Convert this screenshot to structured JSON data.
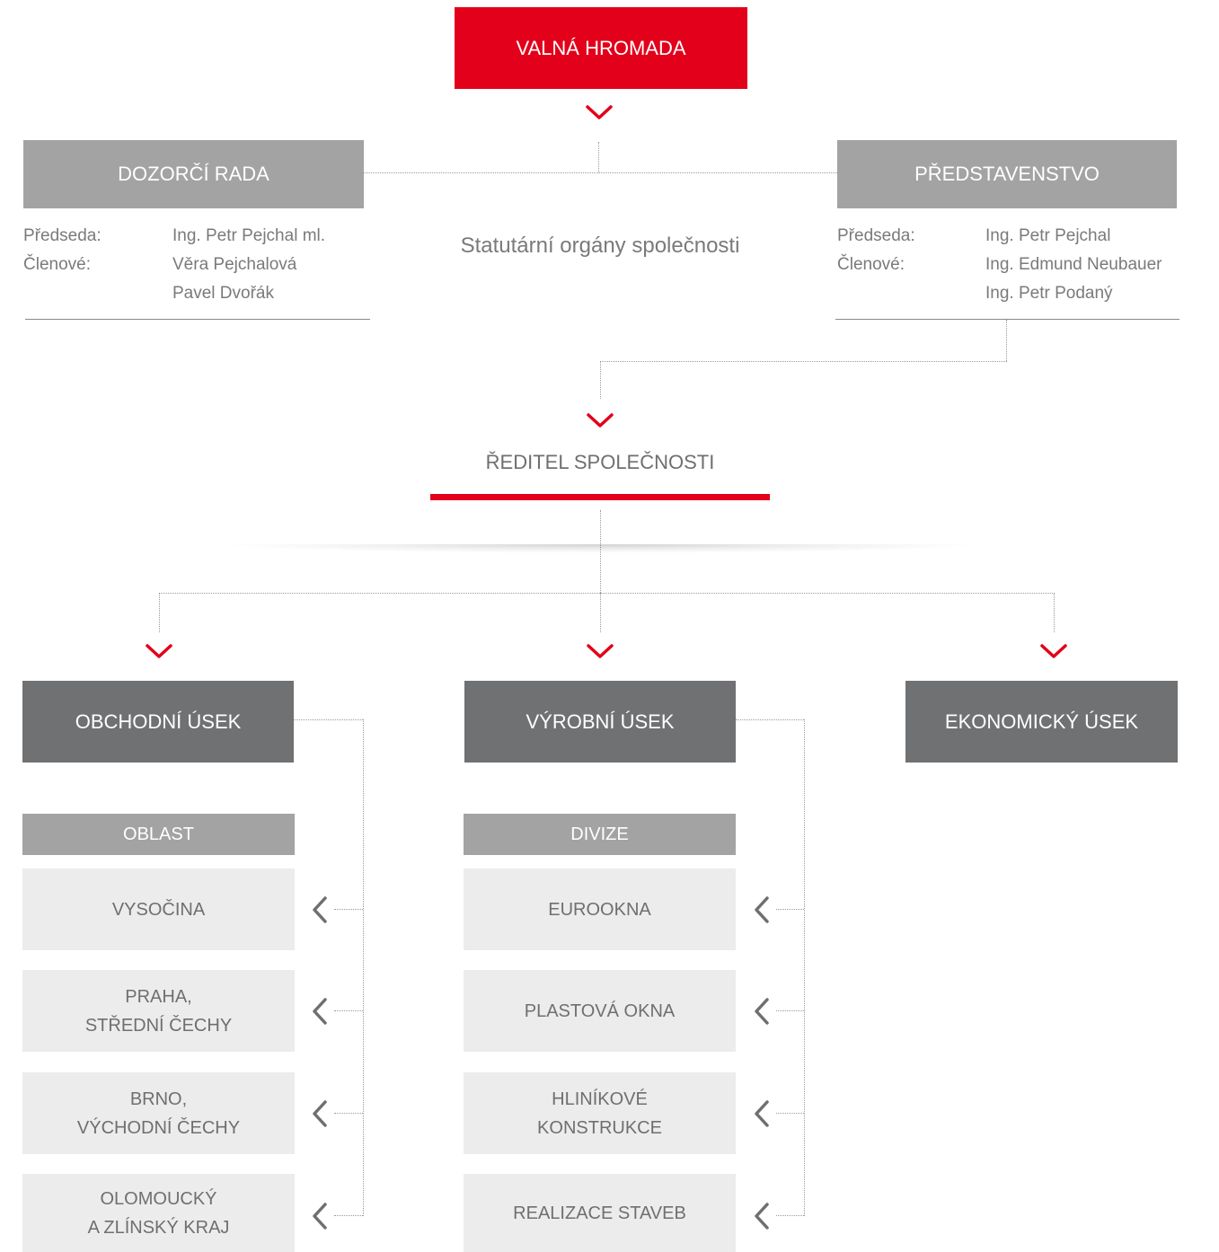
{
  "top": {
    "title": "VALNÁ HROMADA"
  },
  "dozorci": {
    "title": "DOZORČÍ RADA",
    "role_chair": "Předseda:",
    "role_members": "Členové:",
    "chair": "Ing. Petr Pejchal ml.",
    "member_1": "Věra Pejchalová",
    "member_2": "Pavel Dvořák"
  },
  "statutory_label": "Statutární orgány společnosti",
  "predstavenstvo": {
    "title": "PŘEDSTAVENSTVO",
    "role_chair": "Předseda:",
    "role_members": "Členové:",
    "chair": "Ing. Petr Pejchal",
    "member_1": "Ing. Edmund Neubauer",
    "member_2": "Ing. Petr Podaný"
  },
  "director": {
    "title": "ŘEDITEL SPOLEČNOSTI"
  },
  "divisions": {
    "obchodni": {
      "title": "OBCHODNÍ ÚSEK",
      "sub_label": "OBLAST",
      "items": [
        "VYSOČINA",
        "PRAHA,\nSTŘEDNÍ ČECHY",
        "BRNO,\nVÝCHODNÍ ČECHY",
        "OLOMOUCKÝ\nA ZLÍNSKÝ KRAJ"
      ]
    },
    "vyrobni": {
      "title": "VÝROBNÍ ÚSEK",
      "sub_label": "DIVIZE",
      "items": [
        "EUROOKNA",
        "PLASTOVÁ OKNA",
        "HLINÍKOVÉ\nKONSTRUKCE",
        "REALIZACE STAVEB"
      ]
    },
    "ekonomicky": {
      "title": "EKONOMICKÝ ÚSEK"
    }
  },
  "colors": {
    "accent_red": "#e2001a",
    "box_grey": "#a3a3a3",
    "box_dark": "#707173",
    "box_light": "#ececec",
    "text_grey": "#7a7a7a"
  }
}
